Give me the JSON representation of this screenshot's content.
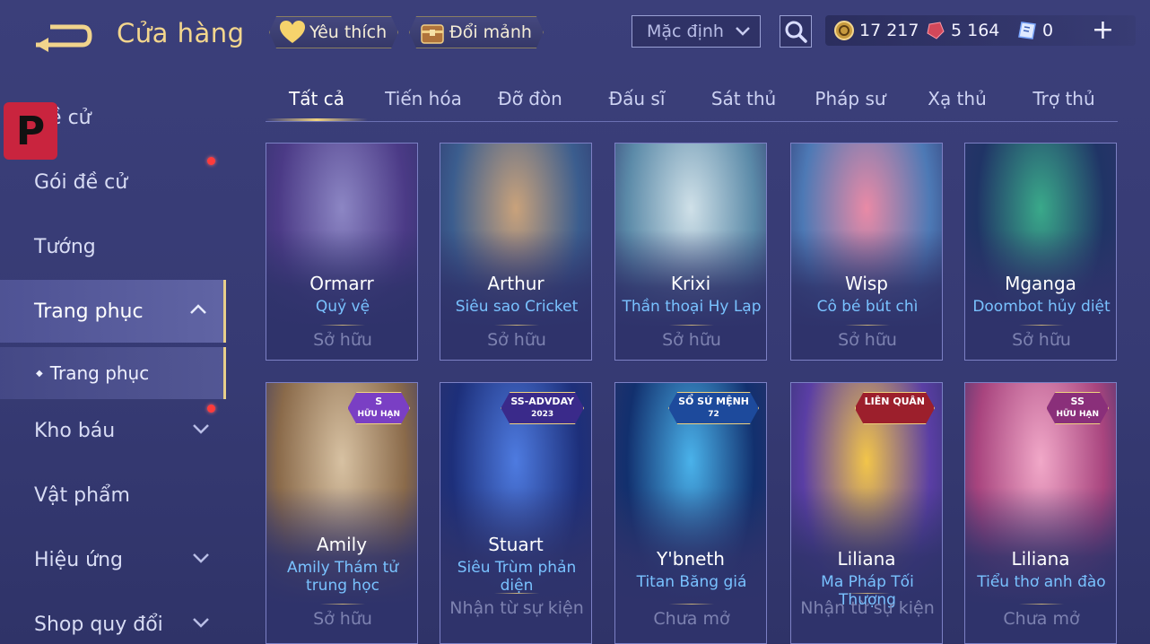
{
  "header": {
    "title": "Cửa hàng",
    "favorites_label": "Yêu thích",
    "exchange_label": "Đổi mảnh",
    "sort": {
      "selected": "Mặc định"
    },
    "currencies": [
      {
        "icon": "gold-coin-icon",
        "value": "17 217"
      },
      {
        "icon": "red-gem-icon",
        "value": "5 164"
      },
      {
        "icon": "voucher-icon",
        "value": "0"
      }
    ]
  },
  "overlay_logo_letter": "P",
  "sidebar": {
    "items": [
      {
        "label": "Đề cử"
      },
      {
        "label": "Gói đề cử"
      },
      {
        "label": "Tướng"
      },
      {
        "label": "Trang phục"
      },
      {
        "label": "Kho báu"
      },
      {
        "label": "Vật phẩm"
      },
      {
        "label": "Hiệu ứng"
      },
      {
        "label": "Shop quy đổi"
      }
    ],
    "sub_item": "Trang phục"
  },
  "tabs": [
    {
      "label": "Tất cả"
    },
    {
      "label": "Tiến hóa"
    },
    {
      "label": "Đỡ đòn"
    },
    {
      "label": "Đấu sĩ"
    },
    {
      "label": "Sát thủ"
    },
    {
      "label": "Pháp sư"
    },
    {
      "label": "Xạ thủ"
    },
    {
      "label": "Trợ thủ"
    }
  ],
  "cards": [
    {
      "hero": "Ormarr",
      "skin": "Quỷ vệ",
      "status": "Sở hữu",
      "badge": null,
      "colors": [
        "#4b3a86",
        "#8c86c4"
      ]
    },
    {
      "hero": "Arthur",
      "skin": "Siêu sao Cricket",
      "status": "Sở hữu",
      "badge": null,
      "colors": [
        "#3b5d8e",
        "#c9a27b"
      ]
    },
    {
      "hero": "Krixi",
      "skin": "Thần thoại Hy Lạp",
      "status": "Sở hữu",
      "badge": null,
      "colors": [
        "#5b8aa8",
        "#cfe0e8"
      ]
    },
    {
      "hero": "Wisp",
      "skin": "Cô bé bút chì",
      "status": "Sở hữu",
      "badge": null,
      "colors": [
        "#4d79b5",
        "#e98aa6"
      ]
    },
    {
      "hero": "Mganga",
      "skin": "Doombot hủy diệt",
      "status": "Sở hữu",
      "badge": null,
      "colors": [
        "#203466",
        "#3aa98a"
      ]
    },
    {
      "hero": "Amily",
      "skin": "Amily Thám tử trung học",
      "status": "Sở hữu",
      "badge": {
        "top": "S",
        "bottom": "HỮU HẠN",
        "color": "#7a3fc4"
      },
      "colors": [
        "#8a6a4a",
        "#d7c1a2"
      ]
    },
    {
      "hero": "Stuart",
      "skin": "Siêu Trùm phản diện",
      "status": "Nhận từ sự kiện",
      "badge": {
        "top": "SS-ADVDAY",
        "bottom": "2023",
        "color": "#3a2a8a"
      },
      "colors": [
        "#1d2f7a",
        "#4e7be0"
      ]
    },
    {
      "hero": "Y'bneth",
      "skin": "Titan Băng giá",
      "status": "Chưa mở",
      "badge": {
        "top": "SỔ SỨ MỆNH",
        "bottom": "72",
        "color": "#1d4a9c"
      },
      "colors": [
        "#12306e",
        "#4ab2ea"
      ]
    },
    {
      "hero": "Liliana",
      "skin": "Ma Pháp Tối Thượng",
      "status": "Nhận từ sự kiện",
      "badge": {
        "top": "LIÊN QUÂN",
        "bottom": "",
        "color": "#9c1f2c"
      },
      "colors": [
        "#5a3ea4",
        "#f2c54a"
      ]
    },
    {
      "hero": "Liliana",
      "skin": "Tiểu thơ anh đào",
      "status": "Chưa mở",
      "badge": {
        "top": "SS",
        "bottom": "HỮU HẠN",
        "color": "#8a2f7a"
      },
      "colors": [
        "#a8447e",
        "#f1a8c8"
      ]
    }
  ]
}
